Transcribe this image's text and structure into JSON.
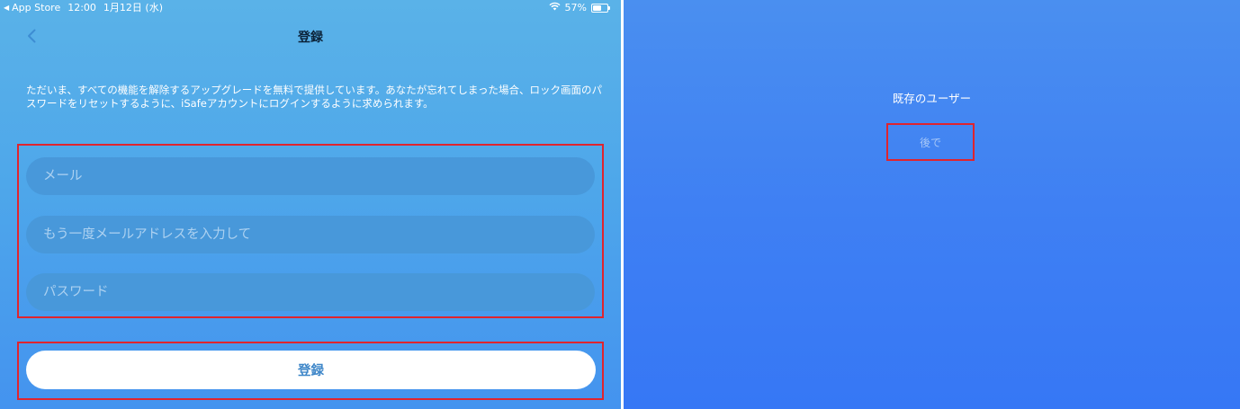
{
  "status_bar": {
    "back_app": "App Store",
    "time": "12:00",
    "date": "1月12日 (水)",
    "battery": "57%",
    "battery_level": 0.57,
    "icons": [
      "back-triangle-icon",
      "wifi-icon",
      "battery-icon"
    ]
  },
  "nav": {
    "back_icon": "chevron-left-icon",
    "title": "登録"
  },
  "description": "ただいま、すべての機能を解除するアップグレードを無料で提供しています。あなたが忘れてしまった場合、ロック画面のパスワードをリセットするように、iSafeアカウントにログインするように求められます。",
  "form": {
    "email": {
      "value": "",
      "placeholder": "メール"
    },
    "email_confirm": {
      "value": "",
      "placeholder": "もう一度メールアドレスを入力して"
    },
    "password": {
      "value": "",
      "placeholder": "パスワード"
    },
    "submit_label": "登録"
  },
  "right": {
    "existing_user": "既存のユーザー",
    "later_label": "後で"
  },
  "colors": {
    "highlight_border": "#e0242e",
    "button_text": "#3f87c9",
    "left_bg_top": "#5ab2e8",
    "right_bg": "#3f80f3"
  }
}
